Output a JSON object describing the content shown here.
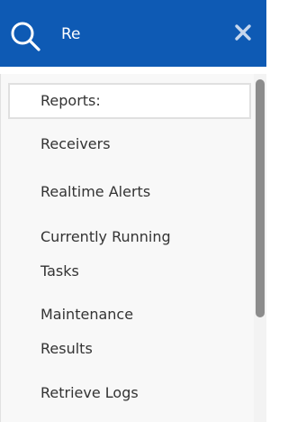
{
  "search": {
    "value": "Re",
    "placeholder": "",
    "search_icon": "search-icon",
    "clear_icon": "close-icon"
  },
  "results": [
    {
      "label": "Reports:",
      "selected": true
    },
    {
      "label": "Receivers",
      "selected": false
    },
    {
      "label": "Realtime Alerts",
      "selected": false
    },
    {
      "label": "Currently Running Tasks",
      "line1": "Currently Running",
      "line2": "Tasks",
      "selected": false
    },
    {
      "label": "Maintenance Results",
      "line1": "Maintenance",
      "line2": "Results",
      "selected": false
    },
    {
      "label": "Retrieve Logs",
      "selected": false
    }
  ],
  "colors": {
    "header_bg": "#0e5ab4",
    "list_bg": "#f8f8f8",
    "text": "#333333",
    "scroll_thumb": "#8c8c8c"
  }
}
